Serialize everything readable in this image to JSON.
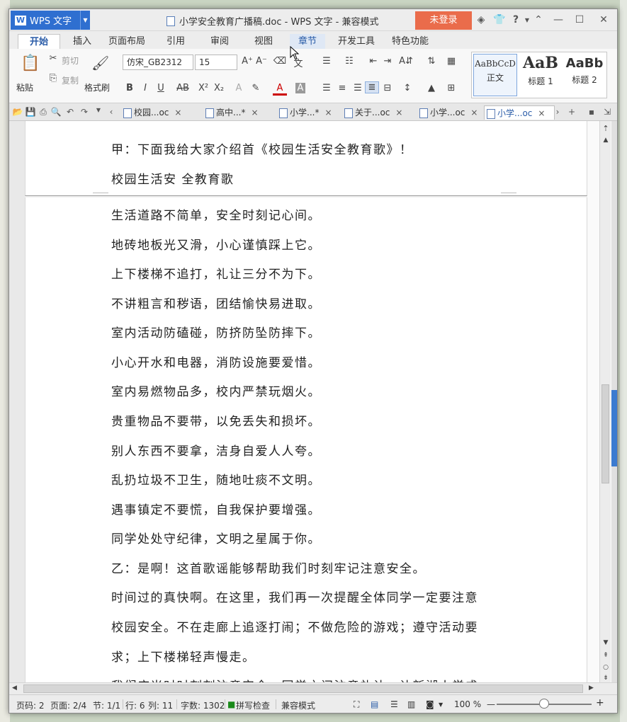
{
  "window": {
    "app_name": "WPS 文字",
    "title": "小学安全教育广播稿.doc - WPS 文字 - 兼容模式",
    "login_label": "未登录",
    "titlebar_icons": [
      "shield-icon",
      "shirt-icon",
      "help-icon",
      "restore-icon",
      "minimize-icon",
      "maximize-icon",
      "close-icon"
    ],
    "help_label": "?"
  },
  "ribbon_tabs": [
    "开始",
    "插入",
    "页面布局",
    "引用",
    "审阅",
    "视图",
    "章节",
    "开发工具",
    "特色功能"
  ],
  "ribbon": {
    "paste_label": "粘贴",
    "cut_label": "剪切",
    "copy_label": "复制",
    "format_painter_label": "格式刷",
    "font_name": "仿宋_GB2312",
    "font_size": "15",
    "bold": "B",
    "italic": "I",
    "underline": "U",
    "strike": "AB",
    "superscript": "X²",
    "subscript": "X₂",
    "font_color_letter": "A",
    "styles": [
      {
        "sample": "AaBbCcD",
        "label": "正文"
      },
      {
        "sample": "AaB",
        "label": "标题 1"
      },
      {
        "sample": "AaBb",
        "label": "标题 2"
      }
    ]
  },
  "doc_tabs": [
    {
      "label": "校园...oc",
      "close": "×"
    },
    {
      "label": "高中...*",
      "close": "×"
    },
    {
      "label": "小学...*",
      "close": "×"
    },
    {
      "label": "关于...oc",
      "close": "×"
    },
    {
      "label": "小学...oc",
      "close": "×"
    },
    {
      "label": "小学...oc",
      "close": "×"
    }
  ],
  "document": {
    "page1_lines": [
      "甲：下面我给大家介绍首《校园生活安全教育歌》！",
      "校园生活安 全教育歌"
    ],
    "page2_lines": [
      "生活道路不简单，安全时刻记心间。",
      "地砖地板光又滑，小心谨慎踩上它。",
      "上下楼梯不追打，礼让三分不为下。",
      "不讲粗言和秽语，团结愉快易进取。",
      "室内活动防磕碰，防挤防坠防摔下。",
      "小心开水和电器，消防设施要爱惜。",
      "室内易燃物品多，校内严禁玩烟火。",
      "贵重物品不要带，以免丢失和损坏。",
      "别人东西不要拿，洁身自爱人人夸。",
      "乱扔垃圾不卫生，随地吐痰不文明。",
      "遇事镇定不要慌，自我保护要增强。",
      "同学处处守纪律，文明之星属于你。",
      "乙：是啊！这首歌谣能够帮助我们时刻牢记注意安全。",
      "时间过的真快啊。在这里，我们再一次提醒全体同学一定要注意",
      "校园安全。不在走廊上追逐打闹；不做危险的游戏；遵守活动要",
      "求；上下楼梯轻声慢走。",
      "我们应当时时刻刻注意安全，同学之间注意礼让，让新湖小学成"
    ]
  },
  "statusbar": {
    "page_code": "页码: 2",
    "pages": "页面: 2/4",
    "section": "节: 1/1",
    "row": "行: 6",
    "col": "列: 11",
    "word_count": "字数: 1302",
    "spell_check": "拼写检查",
    "compat_mode": "兼容模式",
    "zoom": "100 %",
    "zoom_fraction": 0.5
  }
}
